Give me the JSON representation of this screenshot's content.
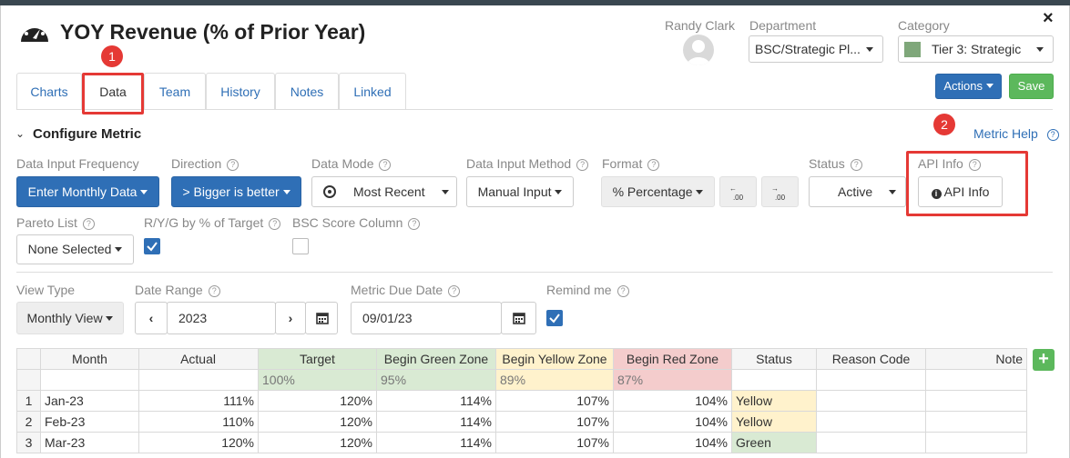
{
  "header": {
    "title": "YOY Revenue (% of Prior Year)",
    "user_name": "Randy Clark",
    "department_label": "Department",
    "department_value": "BSC/Strategic Pl...",
    "category_label": "Category",
    "category_value": "Tier 3: Strategic",
    "category_color": "#7fa77a",
    "actions_label": "Actions",
    "save_label": "Save",
    "close_glyph": "×"
  },
  "tabs": [
    {
      "label": "Charts"
    },
    {
      "label": "Data"
    },
    {
      "label": "Team"
    },
    {
      "label": "History"
    },
    {
      "label": "Notes"
    },
    {
      "label": "Linked"
    }
  ],
  "callouts": {
    "one": "1",
    "two": "2"
  },
  "configure": {
    "heading": "Configure Metric",
    "metric_help": "Metric Help"
  },
  "fields": {
    "frequency": {
      "label": "Data Input Frequency",
      "value": "Enter Monthly Data"
    },
    "direction": {
      "label": "Direction",
      "value": "> Bigger is better"
    },
    "data_mode": {
      "label": "Data Mode",
      "value": "Most Recent"
    },
    "input_method": {
      "label": "Data Input Method",
      "value": "Manual Input"
    },
    "format": {
      "label": "Format",
      "value": "% Percentage",
      "dec_minus": ".00",
      "dec_plus": ".00"
    },
    "status": {
      "label": "Status",
      "value": "Active"
    },
    "api": {
      "label": "API Info",
      "button": "API Info"
    },
    "pareto": {
      "label": "Pareto List",
      "value": "None Selected"
    },
    "ryg": {
      "label": "R/Y/G by % of Target",
      "checked": true
    },
    "bsc": {
      "label": "BSC Score Column",
      "checked": false
    }
  },
  "view": {
    "view_type_label": "View Type",
    "view_type_value": "Monthly View",
    "date_range_label": "Date Range",
    "date_range_value": "2023",
    "due_date_label": "Metric Due Date",
    "due_date_value": "09/01/23",
    "remind_label": "Remind me",
    "remind_checked": true
  },
  "table": {
    "headers": [
      "Month",
      "Actual",
      "Target",
      "Begin Green Zone",
      "Begin Yellow Zone",
      "Begin Red Zone",
      "Status",
      "Reason Code",
      "Note"
    ],
    "zone_defaults": {
      "target": "100%",
      "green": "95%",
      "yellow": "89%",
      "red": "87%"
    },
    "rows": [
      {
        "idx": "1",
        "month": "Jan-23",
        "actual": "111%",
        "target": "120%",
        "green": "114%",
        "yellow": "107%",
        "red": "104%",
        "status": "Yellow"
      },
      {
        "idx": "2",
        "month": "Feb-23",
        "actual": "110%",
        "target": "120%",
        "green": "114%",
        "yellow": "107%",
        "red": "104%",
        "status": "Yellow"
      },
      {
        "idx": "3",
        "month": "Mar-23",
        "actual": "120%",
        "target": "120%",
        "green": "114%",
        "yellow": "107%",
        "red": "104%",
        "status": "Green"
      }
    ],
    "add_glyph": "+"
  },
  "colors": {
    "primary": "#2f6fb6",
    "success": "#5cb85c",
    "callout": "#e53935",
    "green_zone": "#d9ead3",
    "yellow_zone": "#fff2cc",
    "red_zone": "#f4cccc"
  }
}
